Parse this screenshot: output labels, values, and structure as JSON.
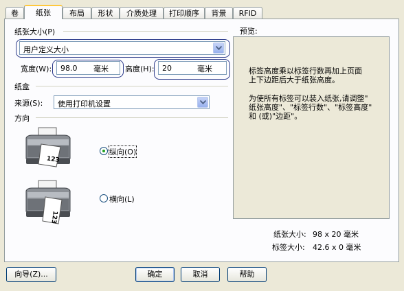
{
  "tabs": [
    "卷",
    "纸张",
    "布局",
    "形状",
    "介质处理",
    "打印顺序",
    "背景",
    "RFID"
  ],
  "active_tab": 1,
  "paper_size": {
    "label": "纸张大小(P)",
    "selected": "用户定义大小",
    "width_label": "宽度(W):",
    "width_value": "98.0",
    "width_unit": "毫米",
    "height_label": "高度(H):",
    "height_value": "20",
    "height_unit": "毫米"
  },
  "tray": {
    "label": "纸盒",
    "source_label": "来源(S):",
    "source_selected": "使用打印机设置"
  },
  "orientation": {
    "label": "方向",
    "portrait": "纵向(O)",
    "landscape": "横向(L)",
    "selected": "portrait",
    "printer_label": "123"
  },
  "preview": {
    "label": "预览:",
    "message1_line1": "标签高度乘以标签行数再加上页面",
    "message1_line2": "上下边距后大于纸张高度。",
    "message2_line1": "为使所有标签可以装入纸张,请调整\"",
    "message2_line2": "纸张高度\"、\"标签行数\"、\"标签高度\"",
    "message2_line3": "和 (或)\"边距\"。",
    "paper_size_label": "纸张大小:",
    "paper_size_value": "98 x 20  毫米",
    "label_size_label": "标签大小:",
    "label_size_value": "42.6 x 0  毫米"
  },
  "buttons": {
    "wizard": "向导(Z)...",
    "ok": "确定",
    "cancel": "取消",
    "help": "帮助"
  }
}
